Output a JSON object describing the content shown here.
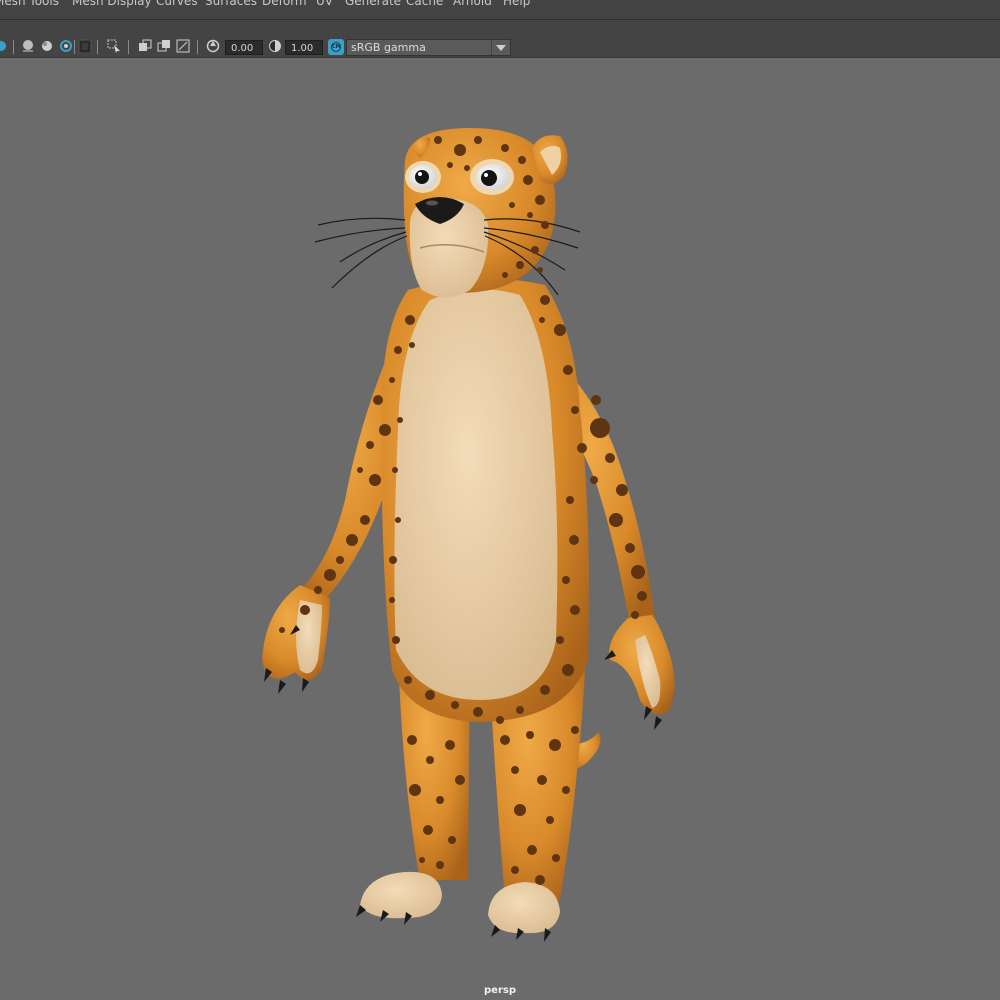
{
  "menu": {
    "items": [
      "Mesh Tools",
      "Mesh Display",
      "Curves",
      "Surfaces",
      "Deform",
      "UV",
      "Generate",
      "Cache",
      "Arnold",
      "Help"
    ]
  },
  "toolbar": {
    "exposure_value": "0.00",
    "gamma_value": "1.00",
    "color_management_badge": "CM",
    "view_transform": "sRGB gamma",
    "accent_color": "#3aa0c8"
  },
  "viewport": {
    "camera_label": "persp",
    "background_color": "#6b6b6b",
    "subject": "cartoon leopard character model"
  },
  "icons": [
    "isolate-sphere-icon",
    "sphere-shade-icon",
    "textured-sphere-icon",
    "rotate-ring-icon",
    "xray-icon",
    "select-tool-icon",
    "copy-icon",
    "paste-icon",
    "resolution-gate-icon",
    "exposure-icon",
    "gamma-icon",
    "color-management-icon"
  ]
}
